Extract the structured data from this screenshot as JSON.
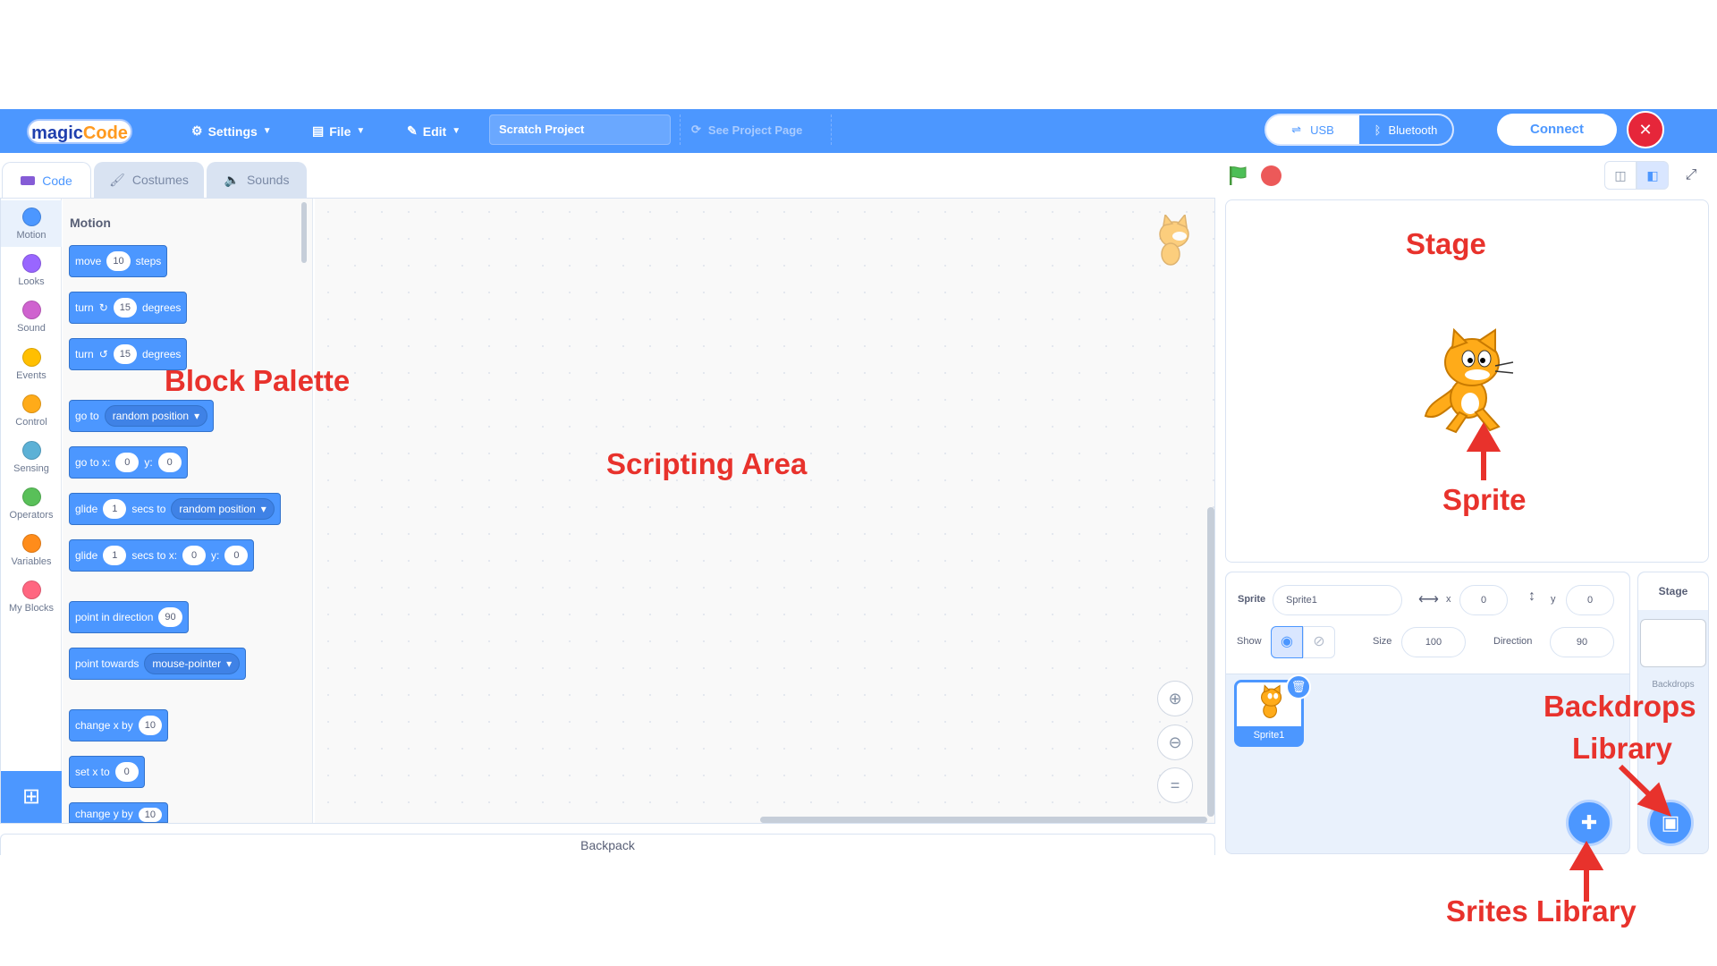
{
  "menubar": {
    "logo_main": "magic",
    "logo_accent": "Code",
    "settings_label": "Settings",
    "file_label": "File",
    "edit_label": "Edit",
    "project_title_value": "Scratch Project",
    "see_project_label": "See Project Page",
    "usb_label": "USB",
    "bluetooth_label": "Bluetooth",
    "connect_label": "Connect"
  },
  "tabs": {
    "code": "Code",
    "costumes": "Costumes",
    "sounds": "Sounds"
  },
  "categories": [
    {
      "label": "Motion",
      "color": "#4c97ff"
    },
    {
      "label": "Looks",
      "color": "#9966ff"
    },
    {
      "label": "Sound",
      "color": "#cf63cf"
    },
    {
      "label": "Events",
      "color": "#ffbf00"
    },
    {
      "label": "Control",
      "color": "#ffab19"
    },
    {
      "label": "Sensing",
      "color": "#5cb1d6"
    },
    {
      "label": "Operators",
      "color": "#59c059"
    },
    {
      "label": "Variables",
      "color": "#ff8c1a"
    },
    {
      "label": "My Blocks",
      "color": "#ff6680"
    }
  ],
  "palette": {
    "heading": "Motion",
    "move": {
      "a": "move",
      "n": "10",
      "b": "steps"
    },
    "turn_right": {
      "a": "turn",
      "n": "15",
      "b": "degrees"
    },
    "turn_left": {
      "a": "turn",
      "n": "15",
      "b": "degrees"
    },
    "go_to": {
      "a": "go to",
      "opt": "random position"
    },
    "go_to_xy": {
      "a": "go to x:",
      "x": "0",
      "y_label": "y:",
      "y": "0"
    },
    "glide_to": {
      "a": "glide",
      "n": "1",
      "b": "secs to",
      "opt": "random position"
    },
    "glide_xy": {
      "a": "glide",
      "n": "1",
      "b": "secs to x:",
      "x": "0",
      "y_label": "y:",
      "y": "0"
    },
    "point_dir": {
      "a": "point in direction",
      "n": "90"
    },
    "point_towards": {
      "a": "point towards",
      "opt": "mouse-pointer"
    },
    "change_x": {
      "a": "change x by",
      "n": "10"
    },
    "set_x": {
      "a": "set x to",
      "n": "0"
    },
    "change_y": {
      "a": "change y by",
      "n": "10"
    }
  },
  "backpack_label": "Backpack",
  "sprite_info": {
    "sprite_label": "Sprite",
    "sprite_name": "Sprite1",
    "x_label": "x",
    "x_value": "0",
    "y_label": "y",
    "y_value": "0",
    "show_label": "Show",
    "size_label": "Size",
    "size_value": "100",
    "direction_label": "Direction",
    "direction_value": "90"
  },
  "sprite_list": [
    {
      "name": "Sprite1"
    }
  ],
  "stage_pane": {
    "title": "Stage",
    "backdrops_label": "Backdrops"
  },
  "annotations": {
    "block_palette": "Block Palette",
    "scripting_area": "Scripting Area",
    "stage": "Stage",
    "sprite": "Sprite",
    "backdrops_library_1": "Backdrops",
    "backdrops_library_2": "Library",
    "sprites_library": "Srites Library"
  },
  "colors": {
    "menubar": "#4c97ff",
    "motion": "#4c97ff",
    "annotation": "#e8322c",
    "stop": "#ec5959",
    "flag": "#4cbf56"
  }
}
